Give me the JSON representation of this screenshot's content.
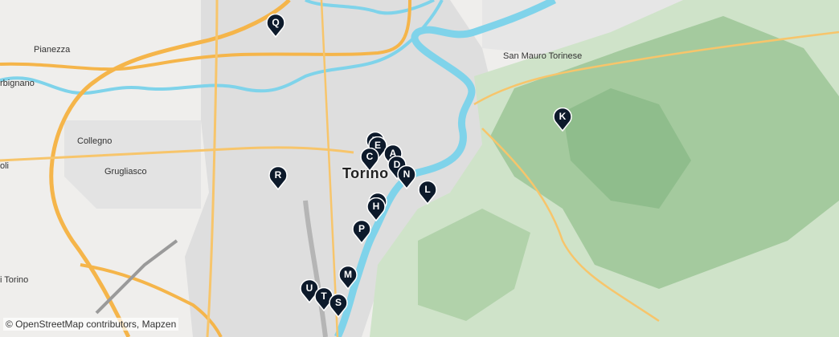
{
  "places": [
    {
      "name": "Pianezza"
    },
    {
      "name": "rbignano"
    },
    {
      "name": "Collegno"
    },
    {
      "name": "Grugliasco"
    },
    {
      "name": "oli"
    },
    {
      "name": "i Torino"
    },
    {
      "name": "San Mauro Torinese"
    },
    {
      "name": "Torino"
    }
  ],
  "markers": [
    {
      "label": "Q"
    },
    {
      "label": "K"
    },
    {
      "label": "B"
    },
    {
      "label": "E"
    },
    {
      "label": "C"
    },
    {
      "label": "A"
    },
    {
      "label": "D"
    },
    {
      "label": "N"
    },
    {
      "label": "L"
    },
    {
      "label": "R"
    },
    {
      "label": "G"
    },
    {
      "label": "H"
    },
    {
      "label": "P"
    },
    {
      "label": "M"
    },
    {
      "label": "U"
    },
    {
      "label": "T"
    },
    {
      "label": "S"
    }
  ],
  "attribution": {
    "icon": "copyright-symbol",
    "text": "© OpenStreetMap contributors, Mapzen"
  },
  "colors": {
    "marker": "#0d1a2b",
    "river": "#46c1e0",
    "highway": "#f5b54a",
    "hills": "#8fbf8b"
  }
}
